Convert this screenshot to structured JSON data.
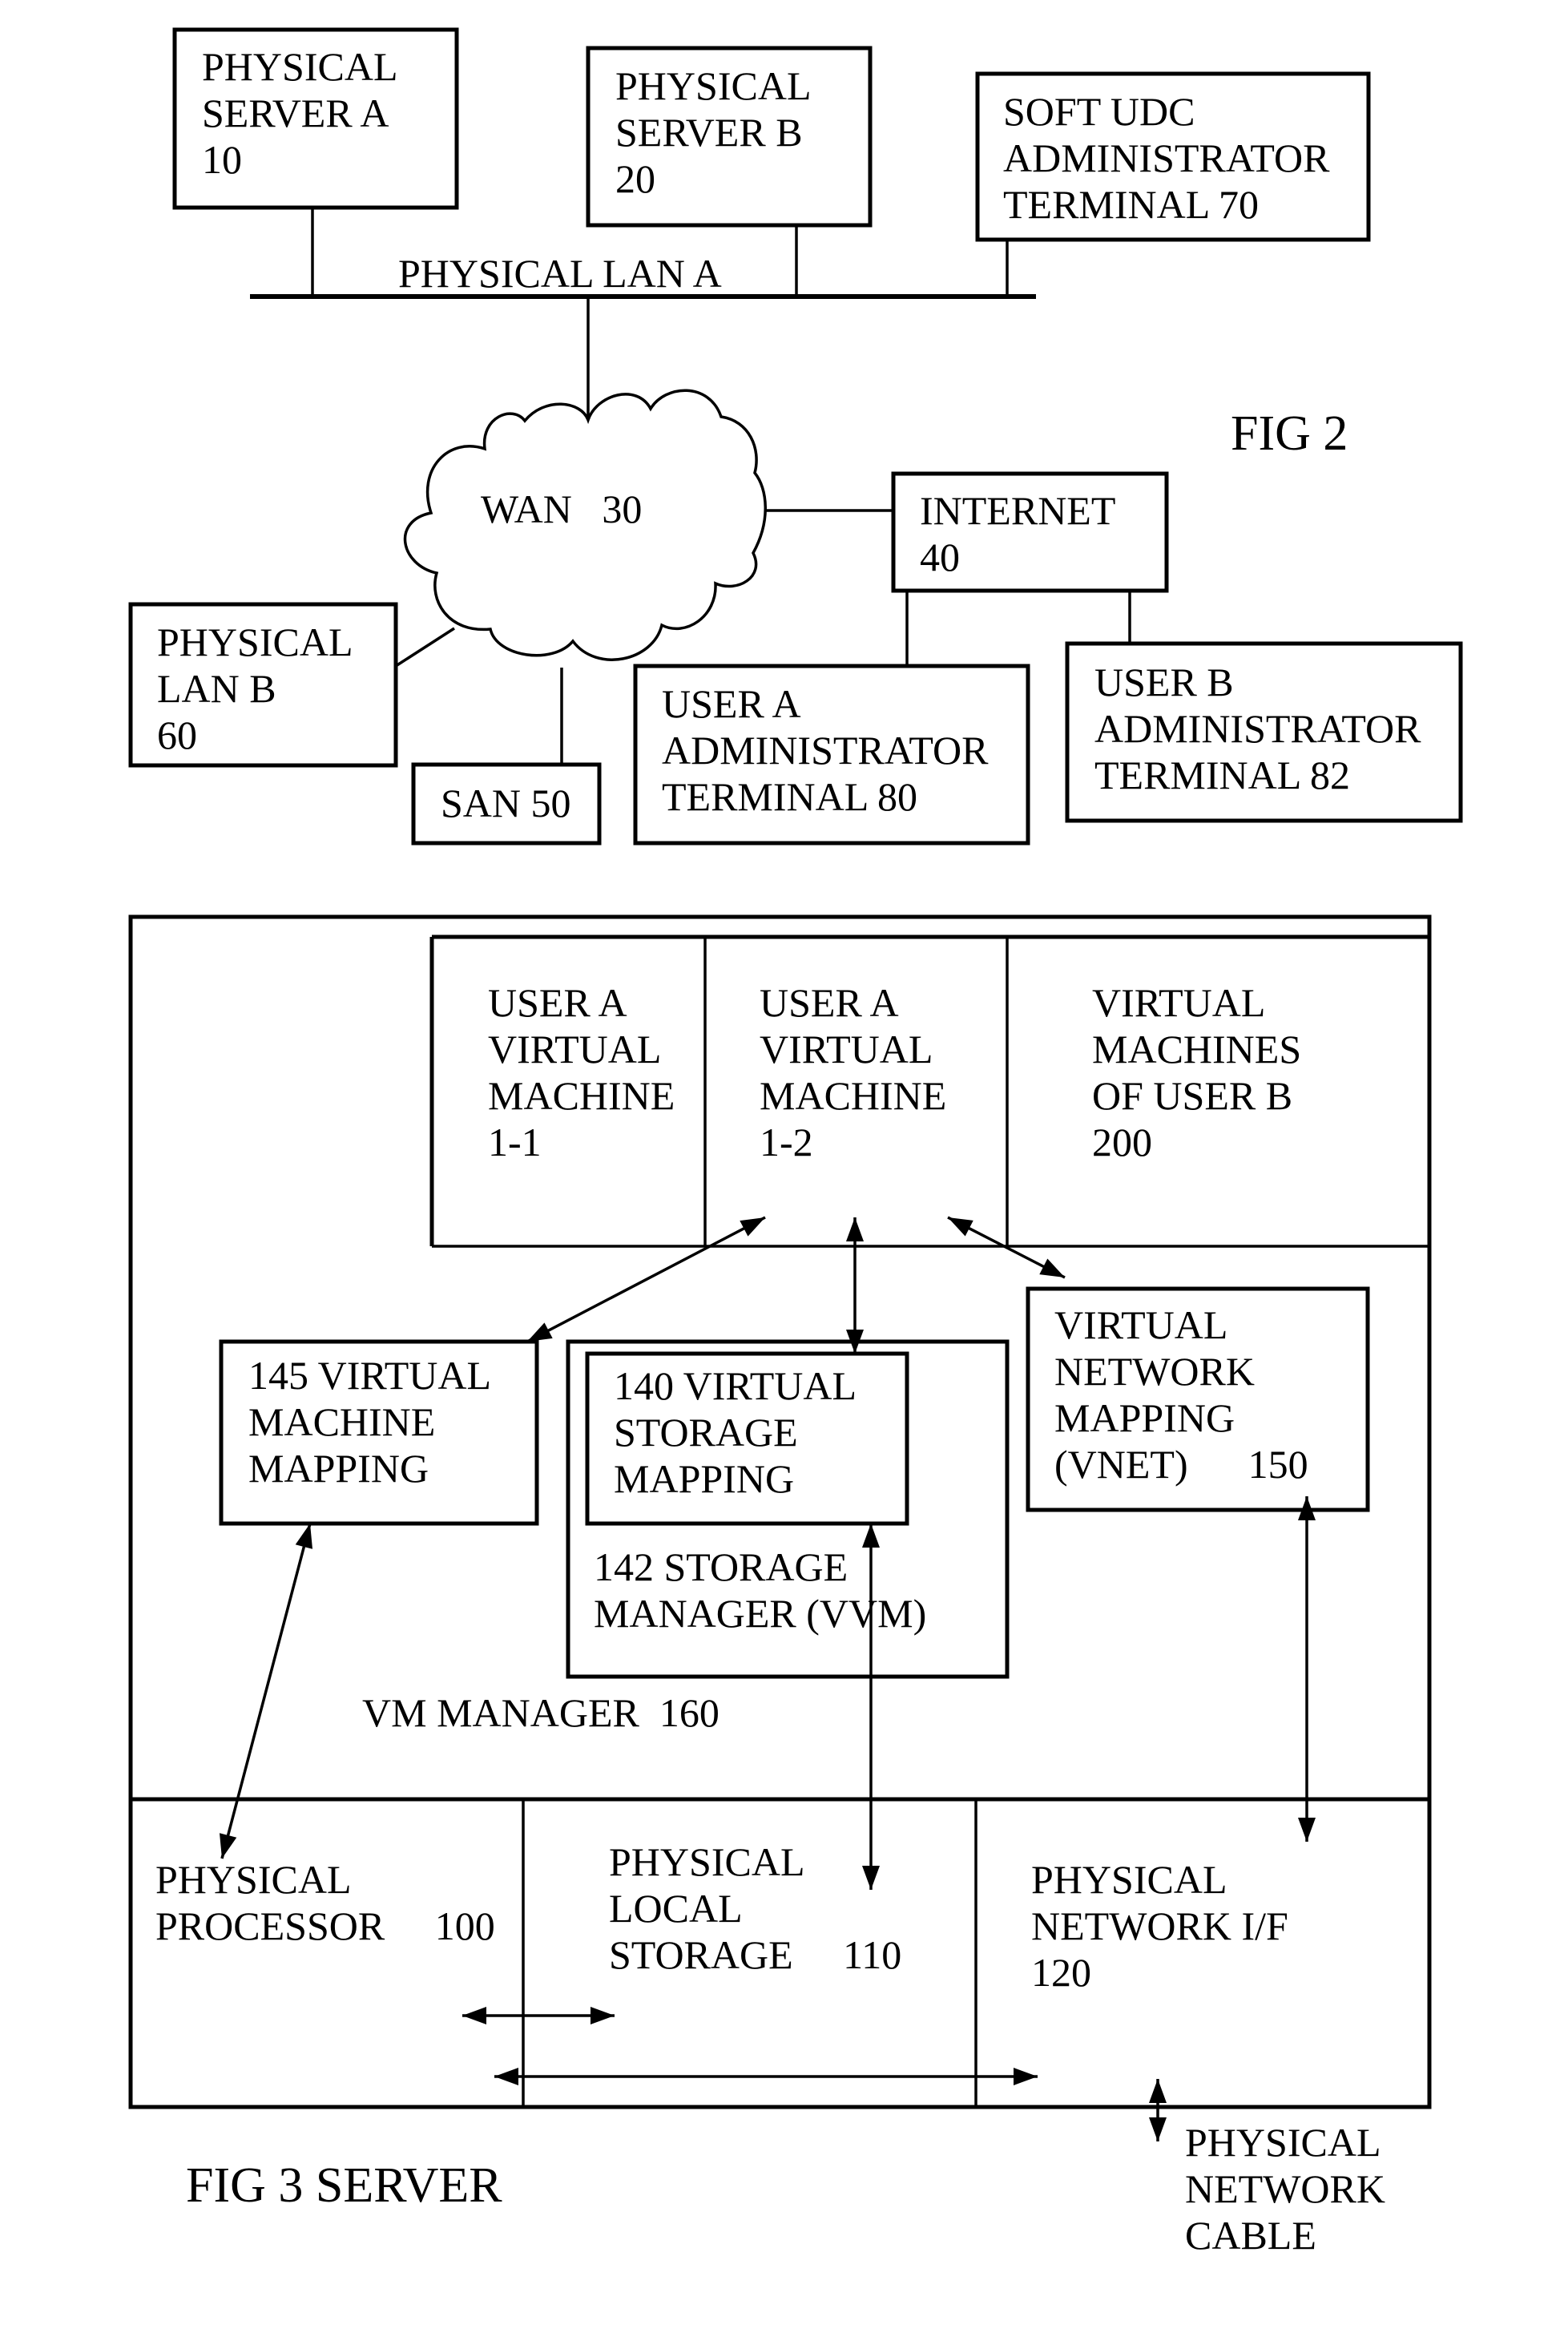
{
  "colors": {
    "ink": "#000000",
    "background": "#ffffff"
  },
  "fig2": {
    "title": "FIG 2",
    "physical_server_a": {
      "lines": [
        "PHYSICAL",
        "SERVER A",
        "10"
      ]
    },
    "physical_server_b": {
      "lines": [
        "PHYSICAL",
        "SERVER B",
        "20"
      ]
    },
    "soft_udc_terminal": {
      "lines": [
        "SOFT UDC",
        "ADMINISTRATOR",
        "TERMINAL 70"
      ]
    },
    "physical_lan_a": {
      "label": "PHYSICAL LAN A"
    },
    "wan": {
      "label": "WAN   30"
    },
    "internet": {
      "lines": [
        "INTERNET",
        "40"
      ]
    },
    "physical_lan_b": {
      "lines": [
        "PHYSICAL",
        "LAN B",
        "60"
      ]
    },
    "san": {
      "lines": [
        "SAN 50"
      ]
    },
    "user_a_terminal": {
      "lines": [
        "USER A",
        "ADMINISTRATOR",
        "TERMINAL 80"
      ]
    },
    "user_b_terminal": {
      "lines": [
        "USER B",
        "ADMINISTRATOR",
        "TERMINAL 82"
      ]
    }
  },
  "fig3": {
    "title": "FIG 3 SERVER",
    "vm_1_1": {
      "lines": [
        "USER A",
        "VIRTUAL",
        "MACHINE",
        "1-1"
      ]
    },
    "vm_1_2": {
      "lines": [
        "USER A",
        "VIRTUAL",
        "MACHINE",
        "1-2"
      ]
    },
    "vms_user_b": {
      "lines": [
        "VIRTUAL",
        "MACHINES",
        "OF USER B",
        "200"
      ]
    },
    "vm_mapping": {
      "lines": [
        "145 VIRTUAL",
        "MACHINE",
        "MAPPING"
      ]
    },
    "virtual_storage_mapping": {
      "lines": [
        "140 VIRTUAL",
        "STORAGE",
        "MAPPING"
      ]
    },
    "storage_manager": {
      "lines": [
        "142 STORAGE",
        "MANAGER (VVM)"
      ]
    },
    "vnet_mapping": {
      "lines": [
        "VIRTUAL",
        "NETWORK",
        "MAPPING",
        "(VNET)      150"
      ]
    },
    "vm_manager": {
      "label": "VM MANAGER  160"
    },
    "physical_processor": {
      "lines": [
        "PHYSICAL",
        "PROCESSOR     100"
      ]
    },
    "physical_local_storage": {
      "lines": [
        "PHYSICAL",
        "LOCAL",
        "STORAGE     110"
      ]
    },
    "physical_network_if": {
      "lines": [
        "PHYSICAL",
        "NETWORK I/F",
        "120"
      ]
    },
    "physical_network_cable": {
      "lines": [
        "PHYSICAL",
        "NETWORK",
        "CABLE"
      ]
    }
  }
}
